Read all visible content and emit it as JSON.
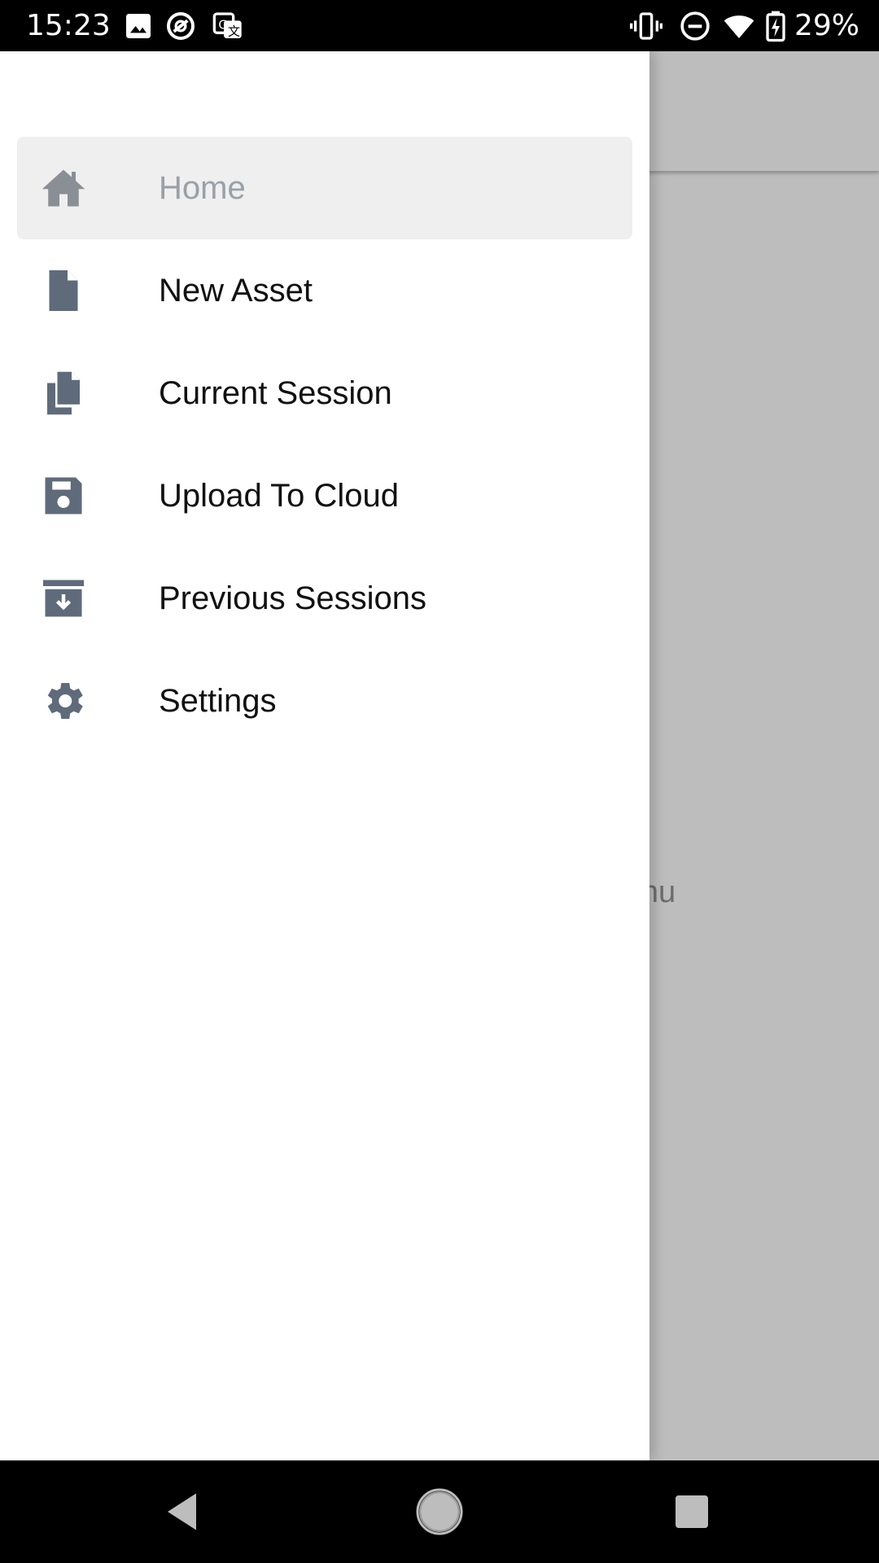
{
  "status_bar": {
    "time": "15:23",
    "battery": "29%",
    "icons": [
      "image-icon",
      "sync-icon",
      "translate-icon",
      "vibrate-icon",
      "dnd-icon",
      "wifi-icon",
      "battery-charging-icon"
    ]
  },
  "background": {
    "hint_text": "n the menu"
  },
  "drawer": {
    "items": [
      {
        "label": "Home",
        "icon": "home-icon",
        "active": true
      },
      {
        "label": "New Asset",
        "icon": "file-icon",
        "active": false
      },
      {
        "label": "Current Session",
        "icon": "copy-icon",
        "active": false
      },
      {
        "label": "Upload To Cloud",
        "icon": "save-icon",
        "active": false
      },
      {
        "label": "Previous Sessions",
        "icon": "archive-icon",
        "active": false
      },
      {
        "label": "Settings",
        "icon": "gear-icon",
        "active": false
      }
    ]
  },
  "colors": {
    "icon": "#5f6b7a",
    "icon_active": "#8a8f96",
    "active_bg": "#efefef",
    "scrim": "#bdbdbd"
  }
}
